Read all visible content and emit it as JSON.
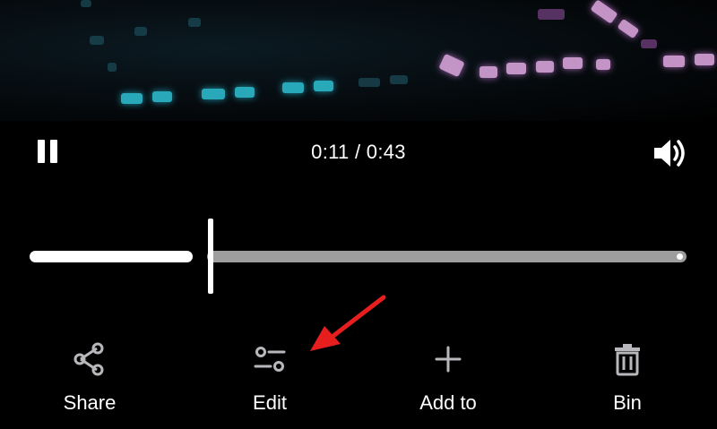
{
  "player": {
    "time_display": "0:11 / 0:43",
    "progress_fraction": 0.256,
    "state": "playing",
    "icons": {
      "pause": "pause-icon",
      "volume": "volume-icon"
    }
  },
  "actions": [
    {
      "label": "Share",
      "icon": "share-icon"
    },
    {
      "label": "Edit",
      "icon": "sliders-icon"
    },
    {
      "label": "Add to",
      "icon": "plus-icon"
    },
    {
      "label": "Bin",
      "icon": "trash-icon"
    }
  ],
  "annotation": {
    "color": "#e61e1e",
    "points_to": "Edit"
  }
}
